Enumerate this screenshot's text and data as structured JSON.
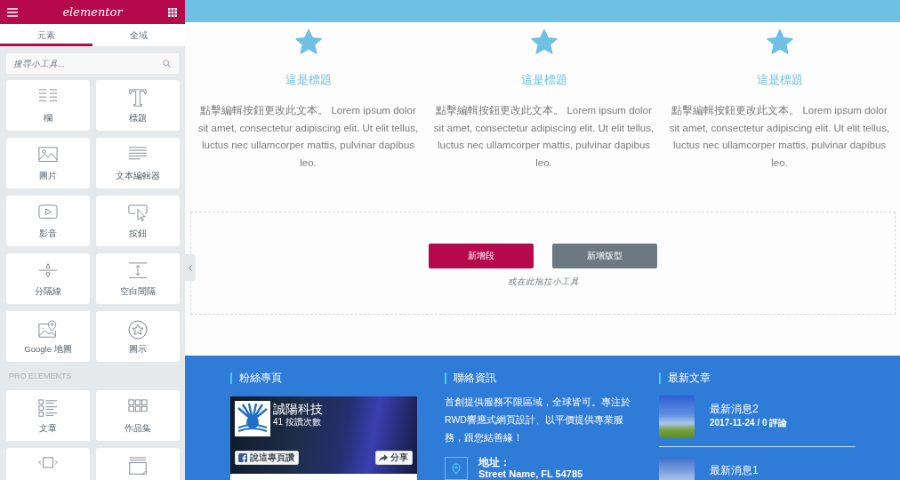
{
  "editor_panel": {
    "logo": "elementor",
    "tabs": [
      {
        "label": "元素",
        "selected": true
      },
      {
        "label": "全域",
        "selected": false
      }
    ],
    "search": {
      "placeholder": "搜尋小工具..."
    },
    "widgets": [
      {
        "kind": "columns",
        "label": "欄"
      },
      {
        "kind": "heading",
        "label": "標題"
      },
      {
        "kind": "image",
        "label": "圖片"
      },
      {
        "kind": "text",
        "label": "文本編輯器"
      },
      {
        "kind": "video",
        "label": "影音"
      },
      {
        "kind": "button",
        "label": "按鈕"
      },
      {
        "kind": "divider",
        "label": "分隔線"
      },
      {
        "kind": "spacer",
        "label": "空白間隔"
      },
      {
        "kind": "map",
        "label": "Google 地圖"
      },
      {
        "kind": "icon",
        "label": "圖示"
      }
    ],
    "pro_section": {
      "title": "PRO ELEMENTS",
      "widgets": [
        {
          "kind": "posts",
          "label": "文章"
        },
        {
          "kind": "portfolio",
          "label": "作品集"
        },
        {
          "kind": "slides"
        },
        {
          "kind": "window"
        }
      ]
    }
  },
  "canvas": {
    "icon_boxes": [
      {
        "title": "這是標題",
        "text": "點擊編輯按鈕更改此文本。 Lorem ipsum dolor sit amet, consectetur adipiscing elit. Ut elit tellus, luctus nec ullamcorper mattis, pulvinar dapibus leo."
      },
      {
        "title": "這是標題",
        "text": "點擊編輯按鈕更改此文本。 Lorem ipsum dolor sit amet, consectetur adipiscing elit. Ut elit tellus, luctus nec ullamcorper mattis, pulvinar dapibus leo."
      },
      {
        "title": "這是標題",
        "text": "點擊編輯按鈕更改此文本。 Lorem ipsum dolor sit amet, consectetur adipiscing elit. Ut elit tellus, luctus nec ullamcorper mattis, pulvinar dapibus leo."
      }
    ],
    "drop_zone": {
      "buttons": [
        {
          "label": "新增段",
          "kind": "primary"
        },
        {
          "label": "新增版型",
          "kind": "secondary"
        }
      ],
      "hint": "或在此拖拉小工具"
    }
  },
  "footer": {
    "fan_page": {
      "heading": "粉絲專頁",
      "page_name": "誠陽科技",
      "likes": "41 按讚次數",
      "like_button": "說這專頁讚",
      "share_button": "分享"
    },
    "contact": {
      "heading": "聯絡資訊",
      "text": "首創提供服務不限區域，全球皆可。專注於RWD響應式網頁設計、以平價提供專業服務，跟您結善緣！",
      "address_label": "地址：",
      "address": "Street Name, FL 54785"
    },
    "recent_posts": {
      "heading": "最新文章",
      "posts": [
        {
          "title": "最新消息2",
          "meta": "2017-11-24 / 0 評論"
        },
        {
          "title": "最新消息1"
        }
      ]
    }
  }
}
